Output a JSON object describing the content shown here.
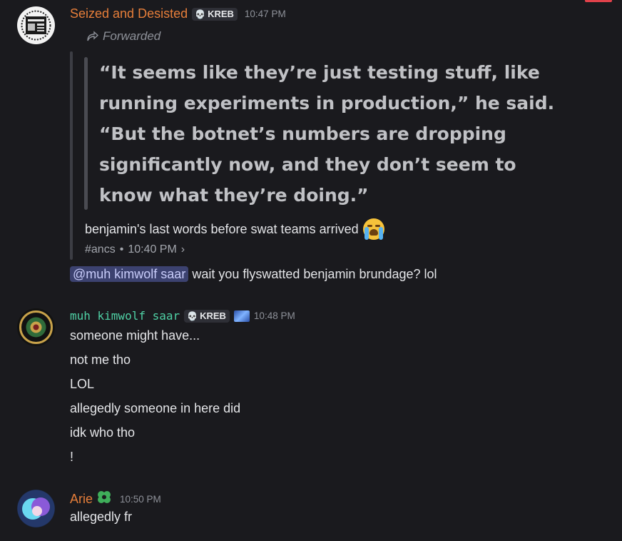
{
  "messages": [
    {
      "username": "Seized and Desisted",
      "username_color": "#e67e3a",
      "tag": "KREB",
      "timestamp": "10:47 PM",
      "forwarded_label": "Forwarded",
      "quote_lines": [
        "“It seems like they’re just testing stuff, like",
        "running experiments in production,” he said.",
        "“But the botnet’s numbers are dropping",
        "significantly now, and they don’t seem to",
        "know what they’re doing.”"
      ],
      "caption": "benjamin's last words before swat teams arrived",
      "channel": "#ancs",
      "channel_time": "10:40 PM",
      "mention": "@muh kimwolf saar",
      "reply_text": "wait you flyswatted benjamin brundage? lol"
    },
    {
      "username": "muh kimwolf saar",
      "username_color": "#4fd1a5",
      "tag": "KREB",
      "timestamp": "10:48 PM",
      "lines": [
        "someone might have...",
        "not me tho",
        "LOL",
        "allegedly someone in here did",
        "idk who tho",
        "!"
      ]
    },
    {
      "username": "Arie",
      "username_color": "#e67e3a",
      "timestamp": "10:50 PM",
      "text": "allegedly fr"
    }
  ],
  "icons": {
    "tag_icon": "skull-icon",
    "forward_icon": "forward-arrow-icon",
    "emoji": "loudly-crying-face",
    "role_icon": "clover-heart-icon",
    "accent": "#5865f2"
  }
}
